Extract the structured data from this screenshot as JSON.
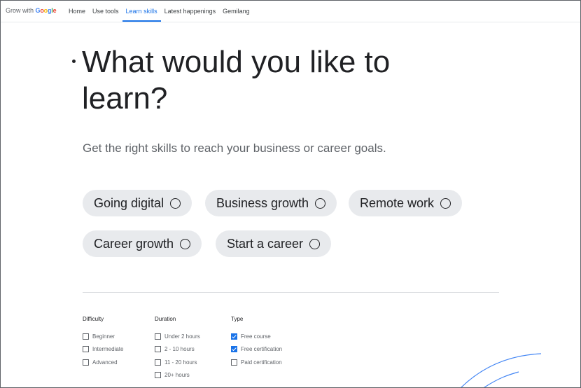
{
  "brand": {
    "prefix": "Grow with",
    "name": "Google"
  },
  "nav": {
    "items": [
      {
        "label": "Home"
      },
      {
        "label": "Use tools"
      },
      {
        "label": "Learn skills",
        "active": true
      },
      {
        "label": "Latest happenings"
      },
      {
        "label": "Gemilang"
      }
    ]
  },
  "hero": {
    "title": "What would you like to learn?",
    "subtitle": "Get the right skills to reach your business or career goals."
  },
  "topics": [
    {
      "label": "Going digital"
    },
    {
      "label": "Business growth"
    },
    {
      "label": "Remote work"
    },
    {
      "label": "Career growth"
    },
    {
      "label": "Start a career"
    }
  ],
  "filters": {
    "difficulty": {
      "heading": "Difficulty",
      "options": [
        {
          "label": "Beginner",
          "checked": false
        },
        {
          "label": "Intermediate",
          "checked": false
        },
        {
          "label": "Advanced",
          "checked": false
        }
      ]
    },
    "duration": {
      "heading": "Duration",
      "options": [
        {
          "label": "Under 2 hours",
          "checked": false
        },
        {
          "label": "2 - 10 hours",
          "checked": false
        },
        {
          "label": "11 - 20 hours",
          "checked": false
        },
        {
          "label": "20+ hours",
          "checked": false
        }
      ]
    },
    "type": {
      "heading": "Type",
      "options": [
        {
          "label": "Free course",
          "checked": true
        },
        {
          "label": "Free certification",
          "checked": true
        },
        {
          "label": "Paid certification",
          "checked": false
        }
      ]
    }
  },
  "colors": {
    "accent": "#1a73e8",
    "text": "#202124",
    "muted": "#5f6368",
    "pill_bg": "#e8eaed",
    "google_blue": "#4285f4",
    "google_red": "#ea4335",
    "google_yellow": "#fbbc05",
    "google_green": "#34a853"
  }
}
